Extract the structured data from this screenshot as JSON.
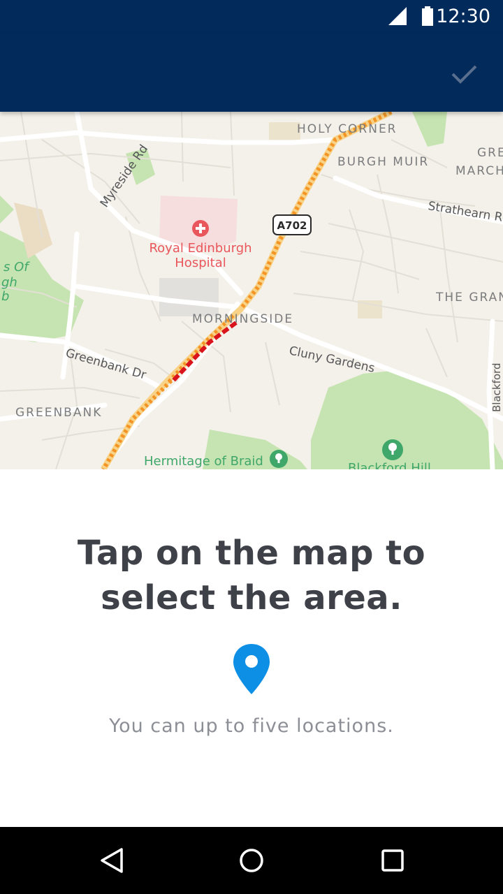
{
  "status_bar": {
    "time": "12:30",
    "icons": [
      "cellular-signal-icon",
      "battery-icon"
    ]
  },
  "app_bar": {
    "background": "#022b5c",
    "action_icon": "check-icon"
  },
  "map": {
    "labels": {
      "holy_corner": "HOLY CORNER",
      "burgh_muir": "BURGH MUIR",
      "grange_march": [
        "GRE",
        "MARCH"
      ],
      "strathearn": "Strathearn Rd",
      "myreside": "Myreside Rd",
      "a702": "A702",
      "hospital": [
        "Royal Edinburgh",
        "Hospital"
      ],
      "golf_left": [
        "s Of",
        "gh",
        "b"
      ],
      "the_grange": "THE GRAN",
      "morningside": "MORNINGSIDE",
      "cluny": "Cluny Gardens",
      "greenbank_dr": "Greenbank Dr",
      "greenbank": "GREENBANK",
      "blackford_road": "Blackford",
      "hermitage": "Hermitage of Braid",
      "blackford_hill": "Blackford Hill"
    },
    "colors": {
      "land": "#f4f1ea",
      "park": "#c6e4b1",
      "traffic_moderate": "#f39425",
      "traffic_heavy": "#d9141c",
      "poi_red": "#e9565b",
      "poi_green": "#3fa76a"
    }
  },
  "panel": {
    "headline_line1": "Tap on the map to",
    "headline_line2": "select the area.",
    "pin_icon": "location-pin-icon",
    "pin_color": "#0d8fe6",
    "subtext": "You can up to five locations."
  },
  "nav_bar": {
    "buttons": [
      "back-icon",
      "home-icon",
      "recents-icon"
    ]
  }
}
